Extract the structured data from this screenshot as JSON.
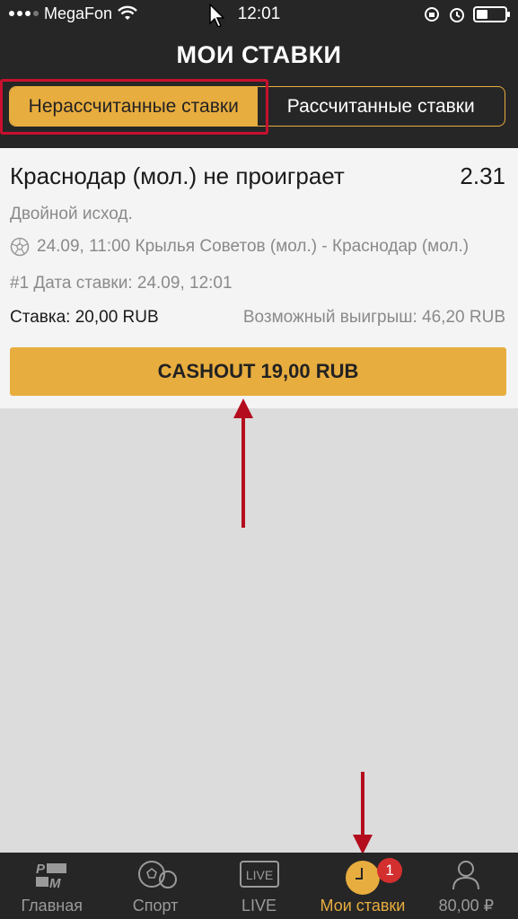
{
  "status_bar": {
    "carrier": "MegaFon",
    "time": "12:01"
  },
  "header": {
    "title": "МОИ СТАВКИ",
    "tabs": [
      {
        "label": "Нерассчитанные ставки",
        "active": true
      },
      {
        "label": "Рассчитанные ставки",
        "active": false
      }
    ]
  },
  "bet": {
    "selection": "Краснодар (мол.) не проиграет",
    "odds": "2.31",
    "market": "Двойной исход.",
    "event": "24.09, 11:00 Крылья Советов (мол.) - Краснодар (мол.)",
    "bet_date": "#1 Дата ставки: 24.09, 12:01",
    "stake": "Ставка: 20,00 RUB",
    "potential_win": "Возможный выигрыш: 46,20 RUB",
    "cashout_label": "CASHOUT 19,00 RUB"
  },
  "bottom_nav": {
    "items": [
      {
        "label": "Главная",
        "icon": "pm-logo-icon"
      },
      {
        "label": "Спорт",
        "icon": "balls-icon"
      },
      {
        "label": "LIVE",
        "icon": "live-tv-icon"
      },
      {
        "label": "Мои ставки",
        "icon": "clock-icon",
        "badge": "1",
        "active": true
      },
      {
        "label": "80,00 ₽",
        "icon": "user-icon"
      }
    ]
  },
  "colors": {
    "accent": "#e8ad3f",
    "dark": "#262626",
    "highlight_red": "#c8102e",
    "arrow_red": "#b30d1e"
  }
}
